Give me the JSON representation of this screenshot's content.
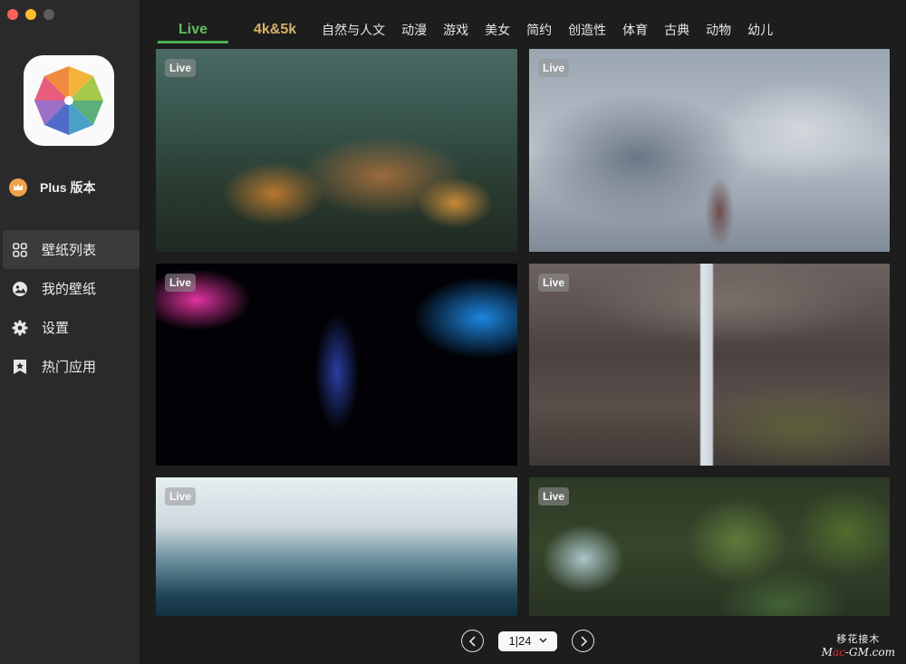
{
  "window": {
    "controls": [
      "close",
      "minimize",
      "zoom"
    ]
  },
  "sidebar": {
    "logo_icon": "pinwheel-app-icon",
    "plus": {
      "icon": "crown-icon",
      "label": "Plus 版本"
    },
    "items": [
      {
        "label": "壁纸列表",
        "icon": "grid-icon",
        "active": true
      },
      {
        "label": "我的壁纸",
        "icon": "image-icon",
        "active": false
      },
      {
        "label": "设置",
        "icon": "gear-icon",
        "active": false
      },
      {
        "label": "热门应用",
        "icon": "star-bookmark-icon",
        "active": false
      }
    ]
  },
  "tabs": [
    {
      "label": "Live",
      "active": true,
      "color": "#5ec05a"
    },
    {
      "label": "4k&5k",
      "color": "#d7b068"
    },
    {
      "label": "自然与人文"
    },
    {
      "label": "动漫"
    },
    {
      "label": "游戏"
    },
    {
      "label": "美女"
    },
    {
      "label": "简约"
    },
    {
      "label": "创造性"
    },
    {
      "label": "体育"
    },
    {
      "label": "古典"
    },
    {
      "label": "动物"
    },
    {
      "label": "幼儿"
    }
  ],
  "wallpapers": [
    {
      "badge": "Live"
    },
    {
      "badge": "Live"
    },
    {
      "badge": "Live"
    },
    {
      "badge": "Live"
    },
    {
      "badge": "Live"
    },
    {
      "badge": "Live"
    }
  ],
  "pager": {
    "value": "1|24",
    "prev_icon": "chevron-left-icon",
    "next_icon": "chevron-right-icon"
  },
  "watermark": {
    "top": "移花接木",
    "bottom_prefix": "M",
    "bottom_red": "ac",
    "bottom_suffix": "-GM.com"
  }
}
